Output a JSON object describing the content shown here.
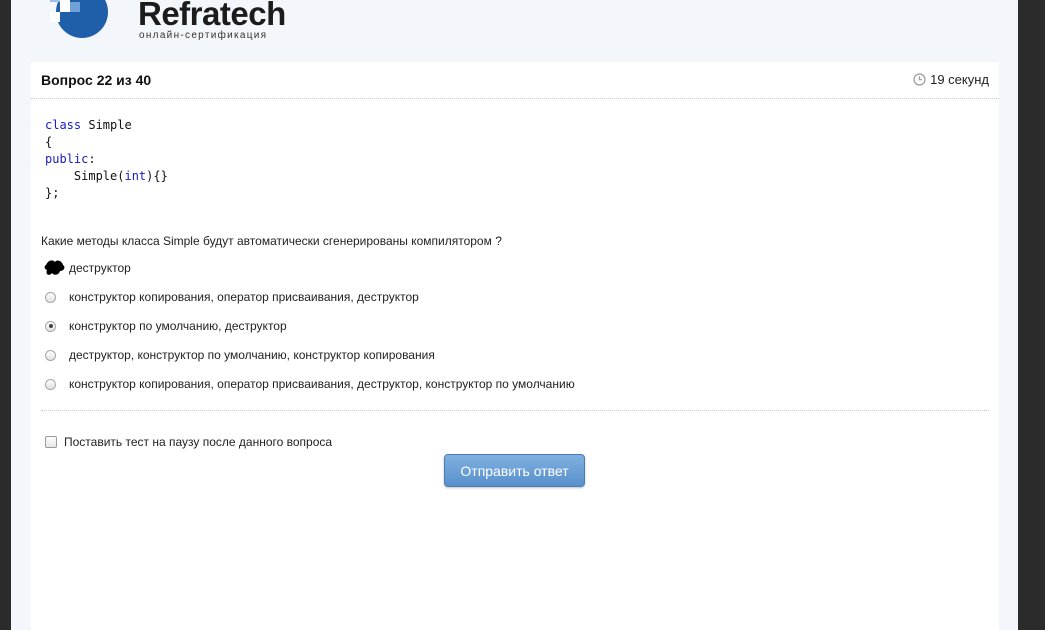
{
  "logo": {
    "name": "Refratech",
    "subtitle": "онлайн-сертификация"
  },
  "header": {
    "question_counter": "Вопрос 22 из 40",
    "timer": "19 секунд",
    "timer_icon": "clock-icon"
  },
  "code_lines": [
    "class Simple",
    "{",
    "public:",
    "    Simple(int){}",
    "};"
  ],
  "question": "Какие методы класса Simple будут автоматически сгенерированы компилятором ?",
  "options": [
    {
      "label": "деструктор",
      "checked": false
    },
    {
      "label": "конструктор копирования, оператор присваивания, деструктор",
      "checked": false
    },
    {
      "label": "конструктор по умолчанию, деструктор",
      "checked": true
    },
    {
      "label": "деструктор, конструктор по умолчанию, конструктор копирования",
      "checked": false
    },
    {
      "label": "конструктор копирования, оператор присваивания, деструктор, конструктор по умолчанию",
      "checked": false
    }
  ],
  "pause": {
    "label": "Поставить тест на паузу после данного вопроса",
    "checked": false
  },
  "submit_label": "Отправить ответ",
  "colors": {
    "keyword": "#1a1ac8",
    "button": "#6a9fd6",
    "logo_blue": "#1f5ea8"
  }
}
